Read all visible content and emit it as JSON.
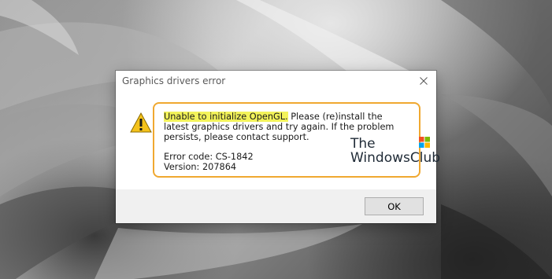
{
  "dialog": {
    "title": "Graphics drivers error",
    "message_highlight": "Unable to initialize OpenGL.",
    "message_rest": " Please (re)install the latest graphics drivers and try again. If the problem persists, please contact support.",
    "error_code": "Error code: CS-1842",
    "version": "Version: 207864",
    "ok_label": "OK",
    "icon": "warning-icon"
  },
  "watermark": {
    "line1": "The",
    "line2": "WindowsClub"
  },
  "colors": {
    "highlight": "#f3f35a",
    "annotation_frame": "#f0a830",
    "warning_yellow": "#f4c21b"
  }
}
